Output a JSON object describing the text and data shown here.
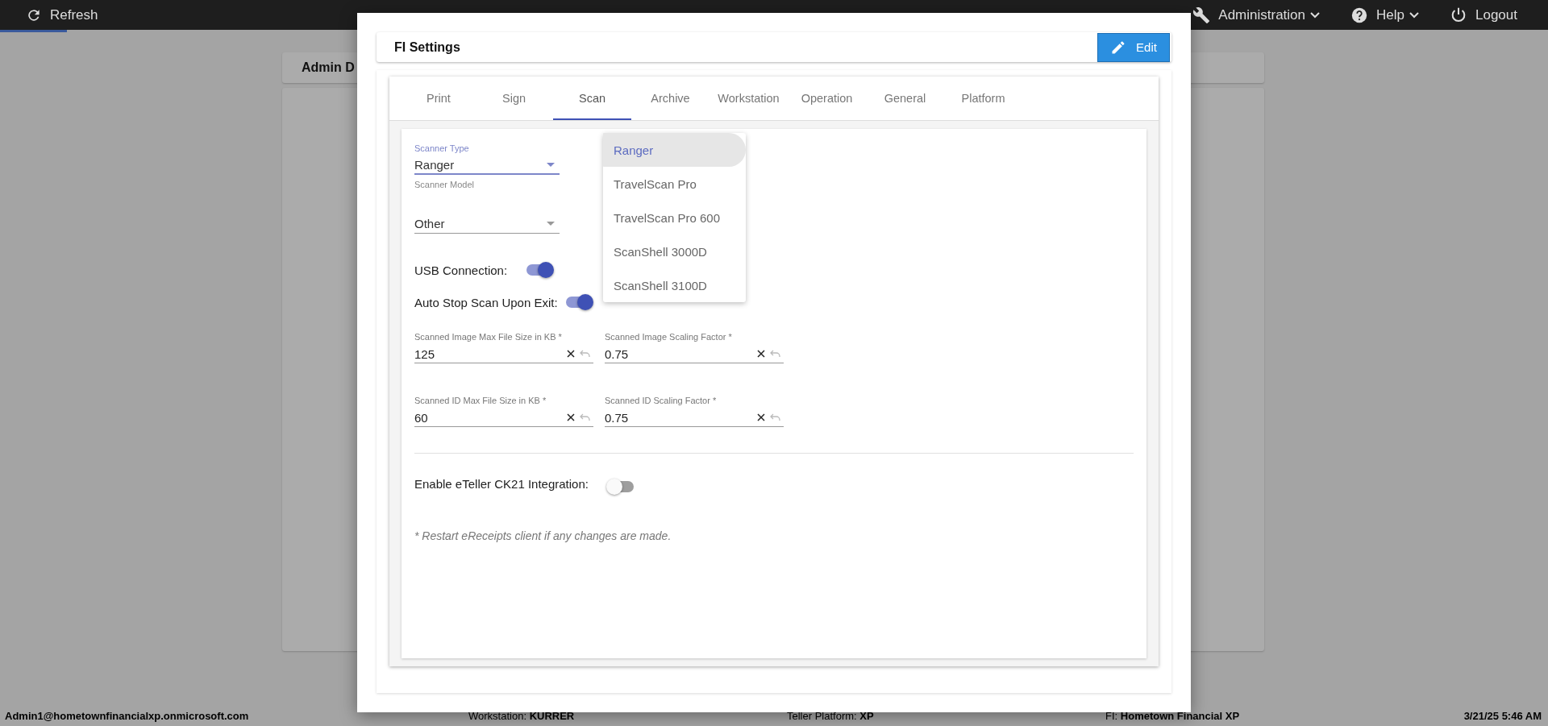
{
  "top_bar": {
    "refresh": "Refresh",
    "menus": [
      {
        "label": "Administration"
      },
      {
        "label": "Help"
      }
    ],
    "logout": "Logout"
  },
  "background_card": {
    "title": "Admin D"
  },
  "dialog": {
    "title": "FI Settings",
    "edit_button": "Edit",
    "tabs": [
      {
        "label": "Print",
        "selected": false
      },
      {
        "label": "Sign",
        "selected": false
      },
      {
        "label": "Scan",
        "selected": true
      },
      {
        "label": "Archive",
        "selected": false
      },
      {
        "label": "Workstation",
        "selected": false
      },
      {
        "label": "Operation",
        "selected": false
      },
      {
        "label": "General",
        "selected": false
      },
      {
        "label": "Platform",
        "selected": false
      }
    ],
    "selects": [
      {
        "label": "Scanner Type",
        "value": "Ranger",
        "focused": true
      },
      {
        "label": "Scanner Model",
        "value": "Other",
        "focused": false
      }
    ],
    "toggles": [
      {
        "label": "USB Connection:",
        "on": true
      },
      {
        "label": "Auto Stop Scan Upon Exit:",
        "on": true
      }
    ],
    "inputs": [
      {
        "label": "Scanned Image Max File Size in KB *",
        "value": "125"
      },
      {
        "label": "Scanned Image Scaling Factor *",
        "value": "0.75"
      },
      {
        "label": "Scanned ID Max File Size in KB *",
        "value": "60"
      },
      {
        "label": "Scanned ID Scaling Factor *",
        "value": "0.75"
      }
    ],
    "integration_toggle": {
      "label": "Enable eTeller CK21 Integration:",
      "on": false
    },
    "note": "* Restart eReceipts client if any changes are made.",
    "dropdown_menu": {
      "options": [
        {
          "label": "Ranger",
          "selected": true
        },
        {
          "label": "TravelScan Pro",
          "selected": false
        },
        {
          "label": "TravelScan Pro 600",
          "selected": false
        },
        {
          "label": "ScanShell 3000D",
          "selected": false
        },
        {
          "label": "ScanShell 3100D",
          "selected": false
        }
      ]
    }
  },
  "status_bar": {
    "user": "Admin1@hometownfinancialxp.onmicrosoft.com",
    "items": [
      {
        "label": "Workstation:",
        "value": "KURRER"
      },
      {
        "label": "Teller Platform:",
        "value": "XP"
      },
      {
        "label": "FI:",
        "value": "Hometown Financial XP"
      }
    ],
    "datetime": "3/21/25 5:46 AM"
  }
}
